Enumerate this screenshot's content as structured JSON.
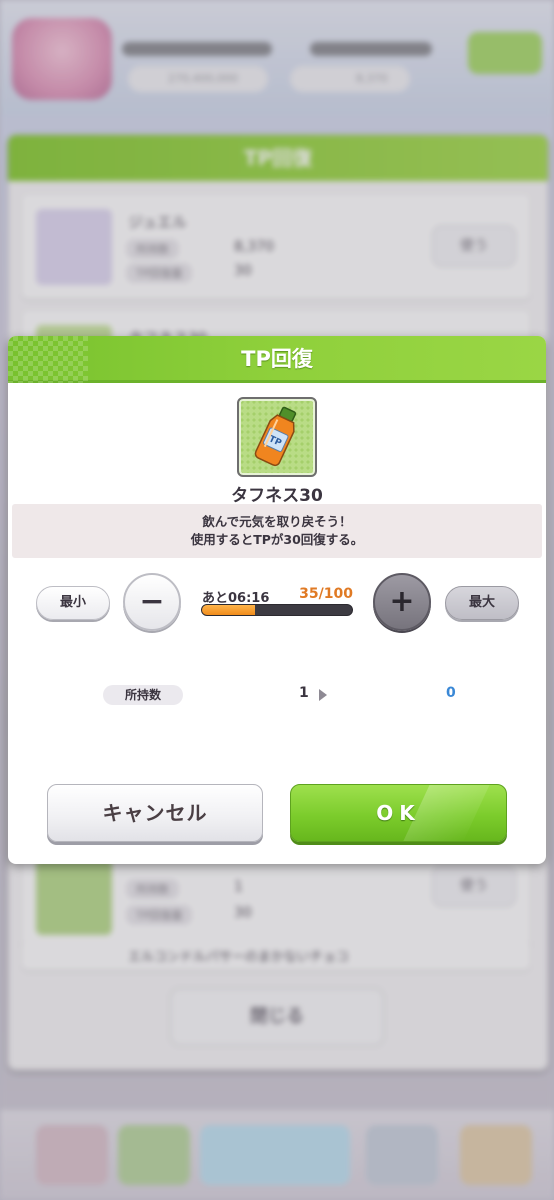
{
  "background": {
    "panel_title": "TP回復",
    "items": [
      {
        "name": "ジュエル",
        "owned_label": "所持数",
        "owned_value": "8,370",
        "tp_label": "TP回復量",
        "tp_value": "30",
        "use_label": "使う"
      },
      {
        "name": "タフネス30",
        "owned_label": "所持数",
        "owned_value": "1",
        "tp_label": "TP回復量",
        "tp_value": "30",
        "use_label": "使う"
      },
      {
        "name": "エルコンドルパサーのまかないチョコ"
      }
    ],
    "close_label": "閉じる",
    "topbar": {
      "currency_1": "270,400,000",
      "currency_2": "8,370"
    }
  },
  "modal": {
    "title": "TP回復",
    "item_icon": "tp-bottle-icon",
    "item_name": "タフネス30",
    "description_line1": "飲んで元気を取り戻そう！",
    "description_line2": "使用するとTPが30回復する。",
    "min_label": "最小",
    "max_label": "最大",
    "minus_symbol": "−",
    "plus_symbol": "+",
    "timer_text": "あと06:16",
    "tp_current_text": "35/100",
    "tp_fraction": 0.35,
    "owned_label": "所持数",
    "owned_before": "1",
    "owned_after": "0",
    "cancel_label": "キャンセル",
    "ok_label": "OK"
  },
  "colors": {
    "header_green": "#8fd03b",
    "tp_orange": "#e07a24",
    "owned_after_blue": "#3a88d6"
  }
}
